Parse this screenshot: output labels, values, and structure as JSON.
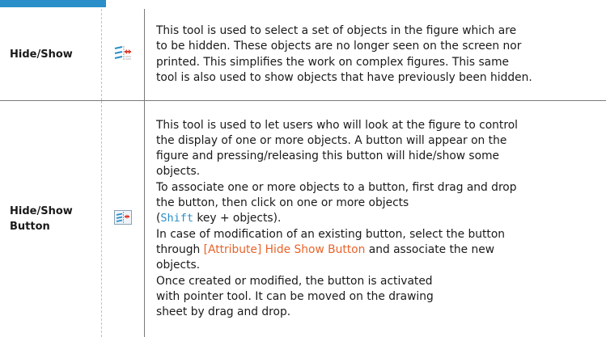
{
  "tools": [
    {
      "name": "Hide/Show",
      "icon": "hide-show-tool-icon",
      "description": [
        "This tool is used to select a set of objects in the figure which are",
        "to be hidden. These objects are no longer seen on the screen nor",
        "printed. This simplifies the work on complex figures. This same",
        "tool is also used to show objects that have previously been hidden."
      ]
    },
    {
      "name_line1": "Hide/Show",
      "name_line2": "Button",
      "icon": "hide-show-button-tool-icon",
      "description": [
        "This tool is used to let users who will look at the figure to control",
        "the display of one or more objects. A button will appear on the",
        "figure and pressing/releasing this button will hide/show some",
        "objects.",
        "To associate one or more objects to a button, first drag and drop",
        "the button, then click on one or more objects"
      ],
      "shift_open": "(",
      "shift_key": "Shift",
      "shift_rest": " key + objects).",
      "modify_line1": "In case of modification of an existing button, select the button",
      "modify_prefix": "through ",
      "modify_ref": "[Attribute] Hide Show Button",
      "modify_suffix": " and associate the new",
      "modify_line3": "objects.",
      "tail": [
        "Once created or modified, the button is activated",
        "with pointer tool. It can be moved on the drawing",
        "sheet by drag and drop."
      ]
    }
  ],
  "colors": {
    "accent": "#2a8fc9",
    "reference": "#e8632a"
  }
}
